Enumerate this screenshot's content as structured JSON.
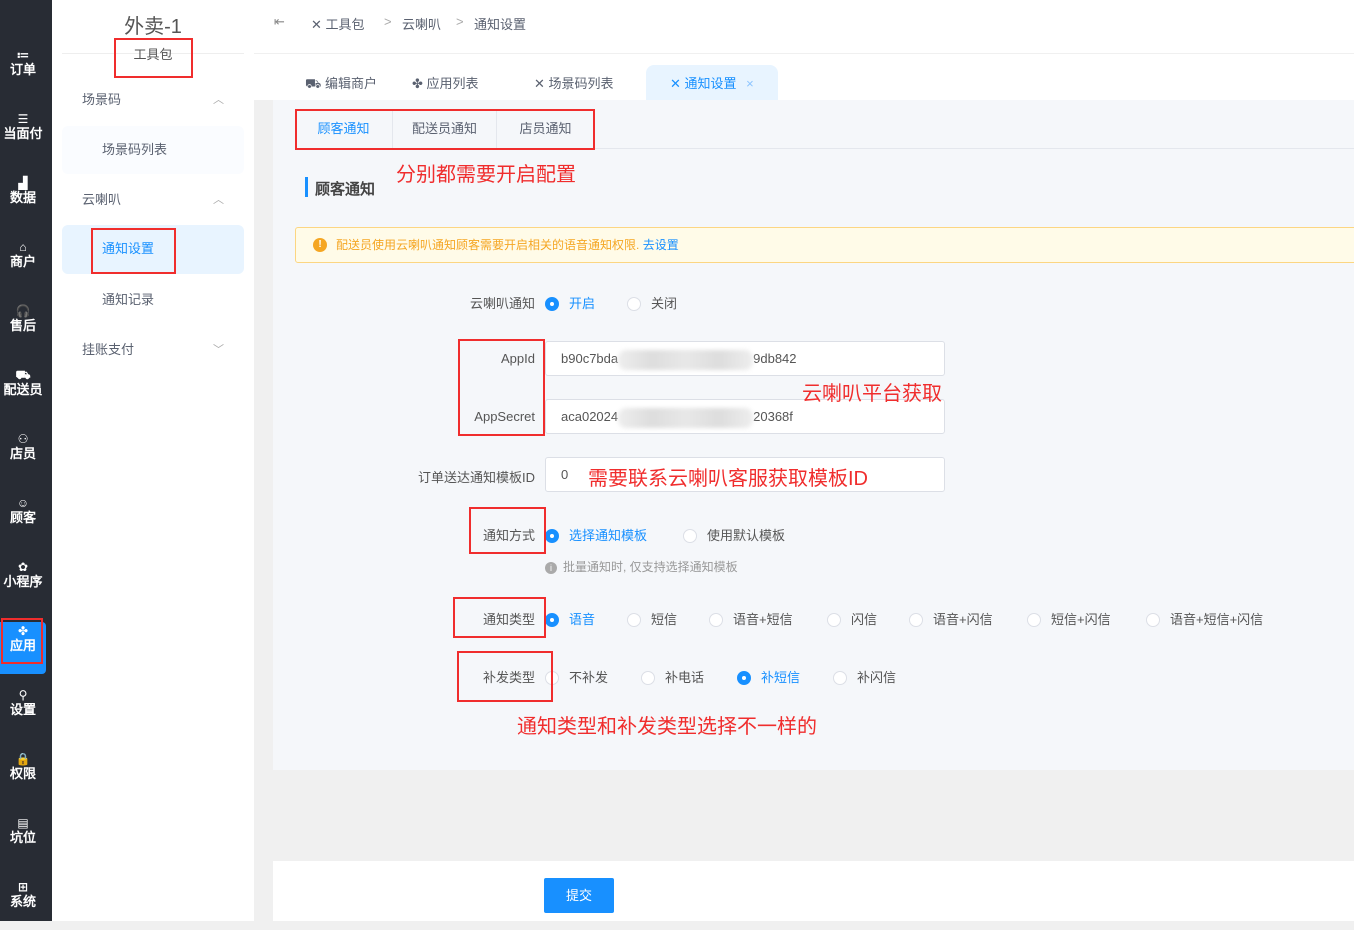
{
  "nav": [
    {
      "label": "订单",
      "icon": "≔"
    },
    {
      "label": "当面付",
      "icon": "☰"
    },
    {
      "label": "数据",
      "icon": "▟"
    },
    {
      "label": "商户",
      "icon": "⌂"
    },
    {
      "label": "售后",
      "icon": "🎧"
    },
    {
      "label": "配送员",
      "icon": "⛟"
    },
    {
      "label": "店员",
      "icon": "⚇"
    },
    {
      "label": "顾客",
      "icon": "☺"
    },
    {
      "label": "小程序",
      "icon": "✿"
    },
    {
      "label": "应用",
      "icon": "✤"
    },
    {
      "label": "设置",
      "icon": "⚲"
    },
    {
      "label": "权限",
      "icon": "🔒"
    },
    {
      "label": "坑位",
      "icon": "▤"
    },
    {
      "label": "系统",
      "icon": "⊞"
    }
  ],
  "menu": {
    "title": "外卖-1",
    "subtitle": "工具包",
    "items": [
      {
        "label": "场景码",
        "chev": "︿"
      },
      {
        "label": "场景码列表"
      },
      {
        "label": "云喇叭",
        "chev": "︿"
      },
      {
        "label": "通知设置"
      },
      {
        "label": "通知记录"
      },
      {
        "label": "挂账支付",
        "chev": "﹀"
      }
    ]
  },
  "breadcrumb": {
    "toggle": "⇤",
    "items": [
      "工具包",
      "云喇叭",
      "通知设置"
    ],
    "sep": ">"
  },
  "tabs": [
    {
      "label": "编辑商户",
      "icon": "⛟"
    },
    {
      "label": "应用列表",
      "icon": "✤"
    },
    {
      "label": "场景码列表",
      "icon": "✕"
    },
    {
      "label": "通知设置",
      "icon": "✕",
      "close": "×"
    }
  ],
  "subtabs": [
    "顾客通知",
    "配送员通知",
    "店员通知"
  ],
  "section_title": "顾客通知",
  "alert": {
    "text": "配送员使用云喇叭通知顾客需要开启相关的语音通知权限.",
    "link": "去设置"
  },
  "form": {
    "enable": {
      "label": "云喇叭通知",
      "options": [
        "开启",
        "关闭"
      ],
      "selected": 0
    },
    "appid": {
      "label": "AppId",
      "prefix": "b90c7bda",
      "suffix": "9db842"
    },
    "appsecret": {
      "label": "AppSecret",
      "prefix": "aca02024",
      "suffix": "20368f"
    },
    "template": {
      "label": "订单送达通知模板ID",
      "value": "0"
    },
    "method": {
      "label": "通知方式",
      "options": [
        "选择通知模板",
        "使用默认模板"
      ],
      "selected": 0,
      "hint": "批量通知时, 仅支持选择通知模板"
    },
    "type": {
      "label": "通知类型",
      "options": [
        "语音",
        "短信",
        "语音+短信",
        "闪信",
        "语音+闪信",
        "短信+闪信",
        "语音+短信+闪信"
      ],
      "selected": 0
    },
    "resend": {
      "label": "补发类型",
      "options": [
        "不补发",
        "补电话",
        "补短信",
        "补闪信"
      ],
      "selected": 2
    }
  },
  "submit": "提交",
  "annotations": {
    "tabs": "分别都需要开启配置",
    "platform": "云喇叭平台获取",
    "template": "需要联系云喇叭客服获取模板ID",
    "types": "通知类型和补发类型选择不一样的"
  },
  "colors": {
    "primary": "#1890ff",
    "annotation": "#f02d2d",
    "sidebar": "#282c34"
  }
}
